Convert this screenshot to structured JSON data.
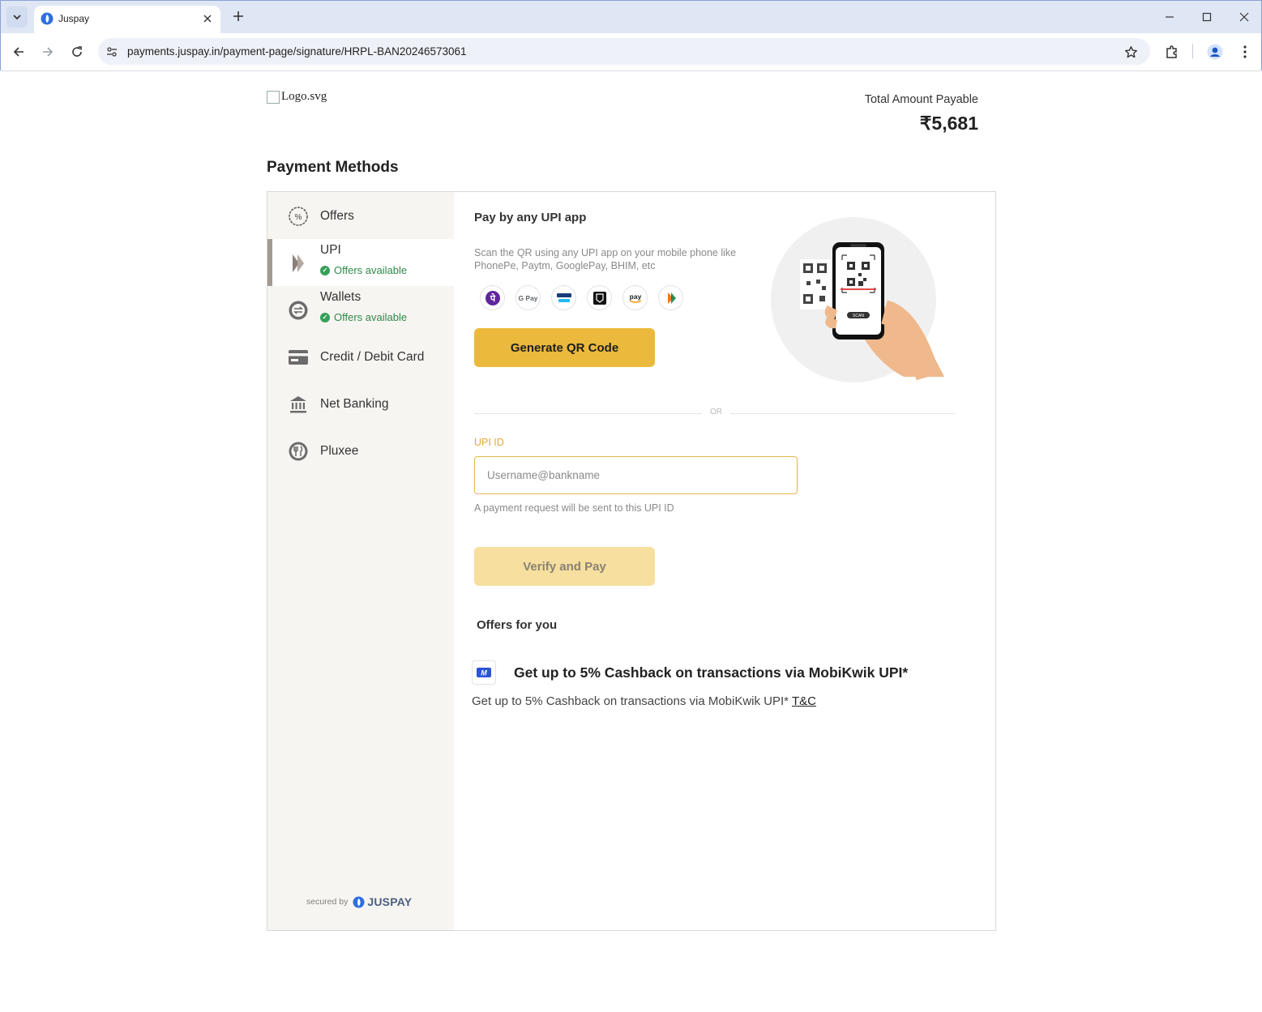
{
  "browser": {
    "tab_title": "Juspay",
    "url": "payments.juspay.in/payment-page/signature/HRPL-BAN20246573061"
  },
  "header": {
    "logo_alt": "Logo.svg",
    "amount_label": "Total Amount Payable",
    "amount": "₹5,681"
  },
  "page_title": "Payment Methods",
  "sidebar": {
    "items": [
      {
        "label": "Offers",
        "icon": "percent-badge-icon"
      },
      {
        "label": "UPI",
        "sub": "Offers available",
        "icon": "upi-icon"
      },
      {
        "label": "Wallets",
        "sub": "Offers available",
        "icon": "wallet-icon"
      },
      {
        "label": "Credit / Debit Card",
        "icon": "card-icon"
      },
      {
        "label": "Net Banking",
        "icon": "bank-icon"
      },
      {
        "label": "Pluxee",
        "icon": "pluxee-icon"
      }
    ],
    "secured_by": "secured by",
    "secured_brand": "JUSPAY"
  },
  "upi": {
    "title": "Pay by any UPI app",
    "description": "Scan the QR using any UPI app on your mobile phone like PhonePe, Paytm, GooglePay, BHIM, etc",
    "apps": [
      "phonepe-icon",
      "gpay-icon",
      "paytm-icon",
      "cred-icon",
      "amazonpay-icon",
      "bhim-icon"
    ],
    "gpay_text": "G Pay",
    "amazon_text": "pay",
    "generate_qr_label": "Generate QR Code",
    "qr_scan_text": "SCAN",
    "or_text": "OR",
    "upi_id_label": "UPI ID",
    "upi_id_placeholder": "Username@bankname",
    "upi_id_value": "",
    "upi_help": "A payment request will be sent to this UPI ID",
    "verify_label": "Verify and Pay"
  },
  "offers": {
    "title": "Offers for you",
    "heading": "Get up to 5% Cashback on transactions via MobiKwik UPI*",
    "description": "Get up to 5% Cashback on transactions via MobiKwik UPI*",
    "tc_label": "T&C"
  },
  "colors": {
    "accent_button": "#ebb93b",
    "disabled_button": "#f6df9f",
    "offers_green": "#2e8a4b",
    "sidebar_bg": "#f7f5f1"
  }
}
